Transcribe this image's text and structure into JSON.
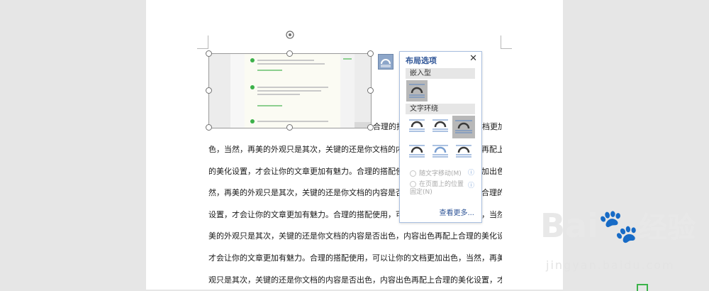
{
  "document": {
    "lines": [
      "合理的搭配使用，可以让你的文档更加出",
      "色，当然，再美的外观只是其次，关键的还是你文档的内容是否出色，内容出色再配上合理",
      "的美化设置，才会让你的文章更加有魅力。合理的搭配使用，可以让你的文档更加出色，当",
      "然，再美的外观只是其次，关键的还是你文档的内容是否出色，内容出色再配上合理的美化",
      "设置，才会让你的文章更加有魅力。合理的搭配使用，可以让你的文档更加出色，当然，再",
      "美的外观只是其次，关键的还是你文档的内容是否出色，内容出色再配上合理的美化设置，",
      "才会让你的文章更加有魅力。合理的搭配使用，可以让你的文档更加出色，当然，再美的外",
      "观只是其次，关键的还是你文档的内容是否出色，内容出色再配上合理的美化设置，才会让"
    ]
  },
  "layout_panel": {
    "title": "布局选项",
    "close": "✕",
    "inline_section": "嵌入型",
    "wrap_section": "文字环绕",
    "move_with_text": "随文字移动(M)",
    "fix_position": "在页面上的位置固定(N)",
    "see_more": "查看更多...",
    "info_icon": "ⓘ"
  },
  "watermark": {
    "brand": "Bai",
    "brand_cn": "经验",
    "url": "jingyan.baidu.com"
  },
  "colors": {
    "panel_border": "#a9bfe0",
    "panel_title": "#2f5597",
    "selected_wrap": "#b8b8b8",
    "icon_blue": "#5a86c5"
  }
}
